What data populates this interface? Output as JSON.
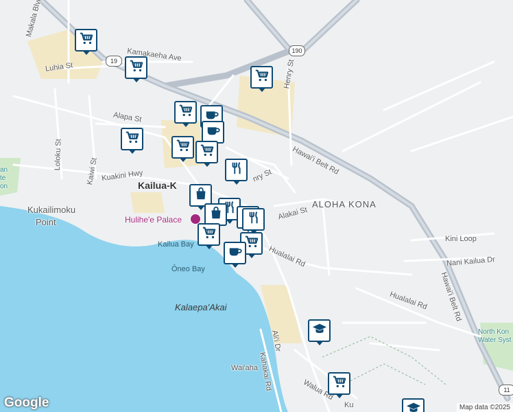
{
  "map": {
    "colors": {
      "water": "#8fd3ee",
      "land": "#eef0f2",
      "sand": "#f2e8c6",
      "highway": "#b9c2cc",
      "road": "#ffffff",
      "poi": "#a3297d",
      "marker": "#0f4a73"
    },
    "labels": {
      "makala": "Makala Blvd",
      "luhia": "Luhia St",
      "kamakaeha": "Kamakaeha Ave",
      "henry_north": "Henry St",
      "alapa": "Alapa St",
      "loloku": "Loloku St",
      "kaiwi": "Kaiwi St",
      "kuakini": "Kuakini Hwy",
      "kailua": "Kailua-K",
      "kukailimoku": "Kukailimoku",
      "point": "Point",
      "hulihee": "Hulihe'e Palace",
      "kailua_bay": "Kailua Bay",
      "oneo_bay": "Ōneo Bay",
      "kalaepa": "Kalaepa'Akai",
      "belt_north": "Hawai'i Belt Rd",
      "henry_south": "nry St",
      "aloha_kona": "ALOHA KONA",
      "alakai": "Alakai St",
      "hualalai_rd": "Hualalai Rd",
      "kini": "Kini Loop",
      "nani": "Nani Kailua Dr",
      "belt_east": "Hawai'i Belt Rd",
      "hualalai_east": "Hualalai Rd",
      "alii": "Ali'i Dr",
      "kahakai": "Kahakai Rd",
      "waiaha": "Wai'aha",
      "walua": "Walua Rd",
      "ku": "Ku",
      "north_kona": "North Kon",
      "water_sys": "Water Syst",
      "left_park_1": "an",
      "left_park_2": "te",
      "left_park_3": "on"
    },
    "shields": {
      "hwy19": "19",
      "hwy190": "190",
      "hwy11": "11"
    },
    "markers": [
      {
        "type": "grocery",
        "icon": "shopping-cart-icon"
      },
      {
        "type": "grocery",
        "icon": "shopping-cart-icon"
      },
      {
        "type": "grocery",
        "icon": "shopping-cart-icon"
      },
      {
        "type": "grocery",
        "icon": "shopping-cart-icon"
      },
      {
        "type": "cafe",
        "icon": "coffee-cup-icon"
      },
      {
        "type": "cafe",
        "icon": "coffee-cup-icon"
      },
      {
        "type": "grocery",
        "icon": "shopping-cart-icon"
      },
      {
        "type": "grocery",
        "icon": "shopping-cart-icon"
      },
      {
        "type": "grocery",
        "icon": "shopping-cart-icon"
      },
      {
        "type": "restaurant",
        "icon": "fork-knife-icon"
      },
      {
        "type": "shopping",
        "icon": "shopping-bag-icon"
      },
      {
        "type": "restaurant",
        "icon": "fork-knife-icon"
      },
      {
        "type": "restaurant",
        "icon": "fork-knife-icon"
      },
      {
        "type": "shopping",
        "icon": "shopping-bag-icon"
      },
      {
        "type": "grocery",
        "icon": "shopping-cart-icon"
      },
      {
        "type": "restaurant",
        "icon": "fork-knife-icon"
      },
      {
        "type": "grocery",
        "icon": "shopping-cart-icon"
      },
      {
        "type": "cafe",
        "icon": "coffee-cup-icon"
      },
      {
        "type": "school",
        "icon": "graduation-cap-icon"
      },
      {
        "type": "grocery",
        "icon": "shopping-cart-icon"
      },
      {
        "type": "school",
        "icon": "graduation-cap-icon"
      }
    ],
    "attribution": {
      "logo": "Google",
      "credit": "Map data ©2025"
    }
  }
}
